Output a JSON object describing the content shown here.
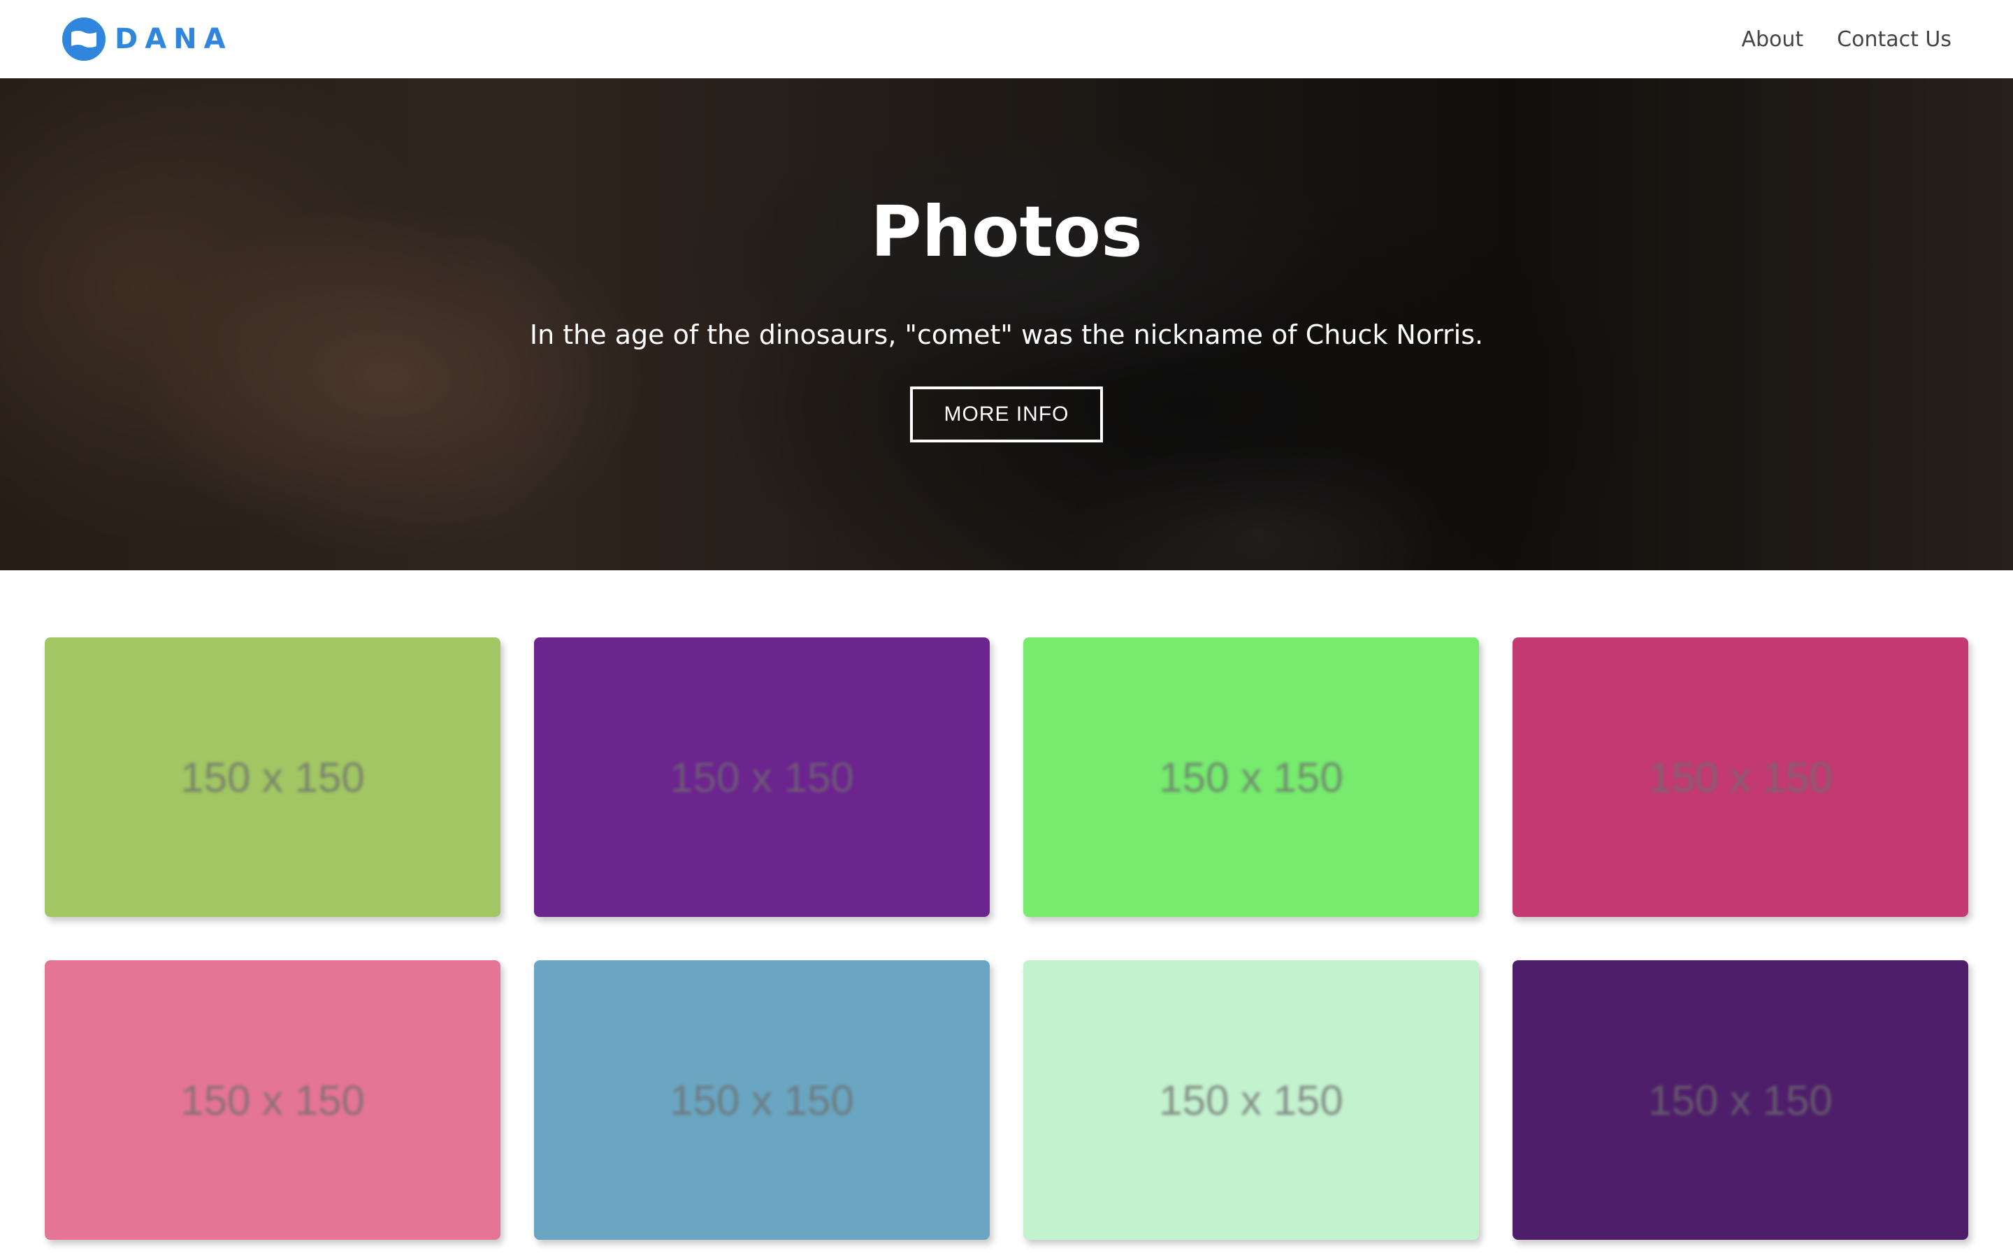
{
  "header": {
    "logo_text": "DANA",
    "brand_color": "#2f86dc",
    "nav": [
      {
        "label": "About"
      },
      {
        "label": "Contact Us"
      }
    ]
  },
  "hero": {
    "title": "Photos",
    "subtitle": "In the age of the dinosaurs, \"comet\" was the nickname of Chuck Norris.",
    "button_label": "MORE INFO"
  },
  "gallery": {
    "tiles": [
      {
        "label": "150 x 150",
        "color": "#a1c663"
      },
      {
        "label": "150 x 150",
        "color": "#6c248f"
      },
      {
        "label": "150 x 150",
        "color": "#76eb6e"
      },
      {
        "label": "150 x 150",
        "color": "#c43a72"
      },
      {
        "label": "150 x 150",
        "color": "#e57595"
      },
      {
        "label": "150 x 150",
        "color": "#6aa6c1"
      },
      {
        "label": "150 x 150",
        "color": "#c3f2cf"
      },
      {
        "label": "150 x 150",
        "color": "#4e1e6b"
      }
    ]
  }
}
